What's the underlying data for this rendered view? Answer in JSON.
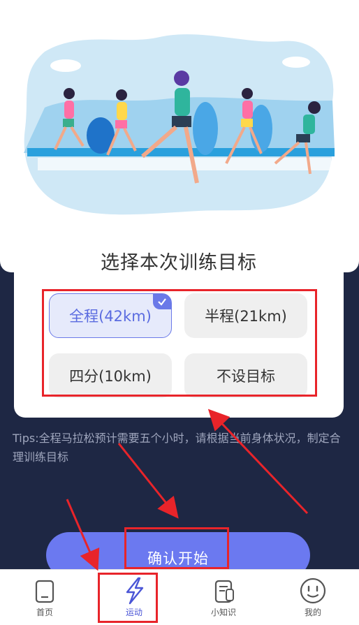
{
  "goal_card": {
    "title": "选择本次训练目标",
    "options": [
      {
        "label": "全程(42km)",
        "selected": true
      },
      {
        "label": "半程(21km)",
        "selected": false
      },
      {
        "label": "四分(10km)",
        "selected": false
      },
      {
        "label": "不设目标",
        "selected": false
      }
    ]
  },
  "tips": "Tips:全程马拉松预计需要五个小时，请根据当前身体状况，制定合理训练目标",
  "confirm_button": {
    "label": "确认开始"
  },
  "tabbar": {
    "tabs": [
      {
        "label": "首页",
        "icon": "home-icon"
      },
      {
        "label": "运动",
        "icon": "lightning-icon",
        "active": true
      },
      {
        "label": "小知识",
        "icon": "book-icon"
      },
      {
        "label": "我的",
        "icon": "smile-face-icon"
      }
    ]
  },
  "colors": {
    "accent": "#6b79f0",
    "page_background": "#1e2744",
    "annotation_red": "#e8242a"
  }
}
